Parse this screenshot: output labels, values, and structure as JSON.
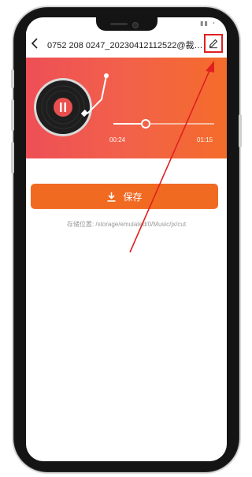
{
  "header": {
    "title": "0752 208 0247_20230412112522@裁剪_..."
  },
  "player": {
    "current_time": "00:24",
    "total_time": "01:15",
    "progress_fraction": 0.32
  },
  "actions": {
    "save_label": "保存"
  },
  "storage": {
    "path_text": "存储位置: /storage/emulated/0/Music/jx/cut"
  },
  "colors": {
    "accent": "#f06a22",
    "gradient_start": "#ee4f56",
    "gradient_end": "#f46c2a",
    "highlight": "#e02020"
  },
  "icons": {
    "back": "back-arrow-icon",
    "edit": "pencil-icon",
    "pause": "pause-icon",
    "download": "download-icon",
    "record": "vinyl-record-icon"
  }
}
